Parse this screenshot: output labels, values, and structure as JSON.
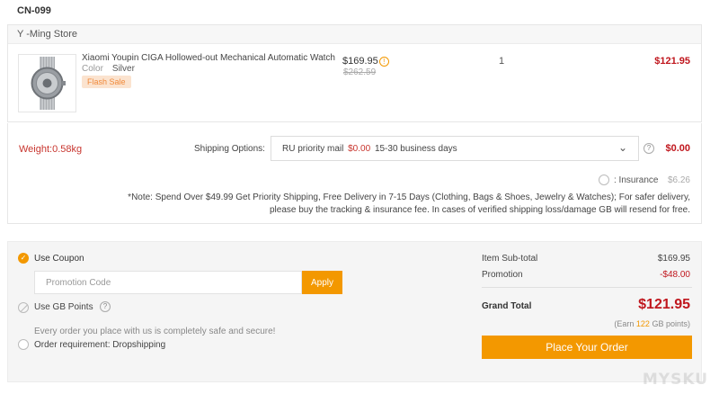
{
  "order_id": "CN-099",
  "store": {
    "name": "Y -Ming Store"
  },
  "product": {
    "name": "Xiaomi Youpin CIGA Hollowed-out Mechanical Automatic Watch",
    "color_label": "Color",
    "color_value": "Silver",
    "badge": "Flash Sale",
    "price": "$169.95",
    "price_info_icon": "info-icon",
    "original_price": "$262.59",
    "quantity": "1",
    "total": "$121.95"
  },
  "shipping": {
    "weight": "Weight:0.58kg",
    "label": "Shipping Options:",
    "method": "RU priority mail",
    "method_cost": "$0.00",
    "method_days": "15-30 business days",
    "cost": "$0.00",
    "insurance_label": ": Insurance",
    "insurance_cost": "$6.26",
    "note": "*Note: Spend Over $49.99 Get Priority Shipping, Free Delivery in 7-15 Days (Clothing, Bags & Shoes, Jewelry & Watches); For safer delivery, please buy the tracking & insurance fee. In cases of verified shipping loss/damage GB will resend for free."
  },
  "checkout": {
    "use_coupon": "Use Coupon",
    "promo_placeholder": "Promotion Code",
    "apply": "Apply",
    "use_gb_points": "Use GB Points",
    "safe_text": "Every order you place with us is completely safe and secure!",
    "order_requirement": "Order requirement: Dropshipping",
    "subtotal_label": "Item Sub-total",
    "subtotal_value": "$169.95",
    "promotion_label": "Promotion",
    "promotion_value": "-$48.00",
    "grand_total_label": "Grand Total",
    "grand_total_value": "$121.95",
    "earn_prefix": "(Earn",
    "earn_points": "122",
    "earn_suffix": "GB points)",
    "place_order": "Place Your Order"
  },
  "colors": {
    "accent": "#f39800",
    "price_red": "#c0171e"
  },
  "watermark": "MYSKU"
}
